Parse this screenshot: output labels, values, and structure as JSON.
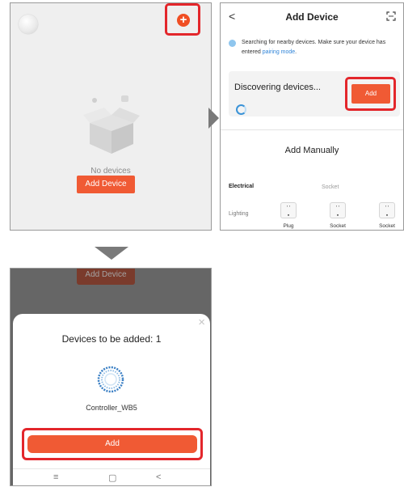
{
  "panel1": {
    "empty_text": "No devices",
    "add_button": "Add Device",
    "accent_color": "#f05a34",
    "icons": [
      "avatar",
      "plus-circle-icon",
      "empty-box-icon"
    ]
  },
  "panel2": {
    "back_glyph": "<",
    "title": "Add Device",
    "search_text": "Searching for nearby devices. Make sure your device has entered",
    "search_link": "pairing mode",
    "search_end": ".",
    "discovering": "Discovering devices...",
    "add_label": "Add",
    "manual_title": "Add Manually",
    "categories": [
      "Electrical",
      "Lighting"
    ],
    "socket_header": "Socket",
    "devices": [
      {
        "label": "Plug"
      },
      {
        "label": "Socket"
      },
      {
        "label": "Socket"
      }
    ]
  },
  "panel3": {
    "ghost_button": "Add Device",
    "close_glyph": "×",
    "title": "Devices to be added: 1",
    "device_name": "Controller_WB5",
    "add_label": "Add",
    "nav": {
      "menu": "≡",
      "home": "▢",
      "back": "<"
    }
  },
  "colors": {
    "highlight": "#e3262b",
    "button": "#f05a34",
    "link": "#2f84d8"
  }
}
